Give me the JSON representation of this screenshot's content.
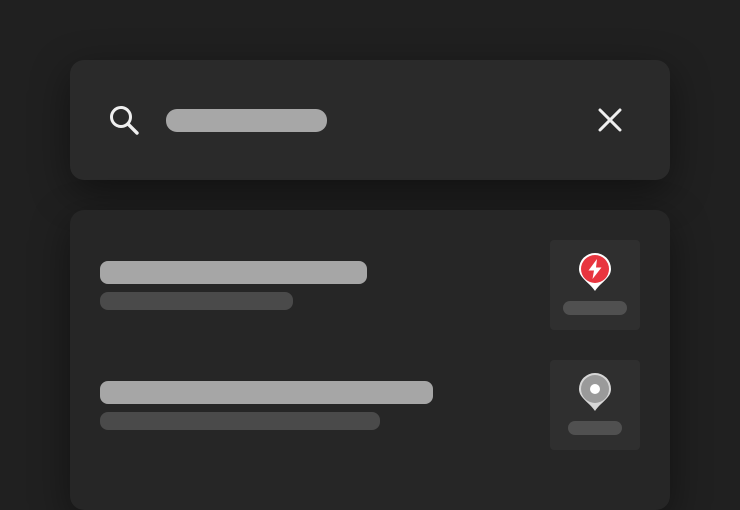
{
  "search": {
    "icon": "search-icon",
    "close_icon": "close-icon",
    "placeholder_bar_color": "#a7a7a7"
  },
  "results": [
    {
      "marker_icon": "lightning-marker-icon",
      "marker_color": "#e8353f"
    },
    {
      "marker_icon": "location-dot-marker-icon",
      "marker_color": "#9a9a9a"
    }
  ],
  "colors": {
    "background": "#202020",
    "card": "#2a2a2a",
    "skeleton_light": "#a6a6a6",
    "skeleton_dark": "#4a4a4a"
  }
}
